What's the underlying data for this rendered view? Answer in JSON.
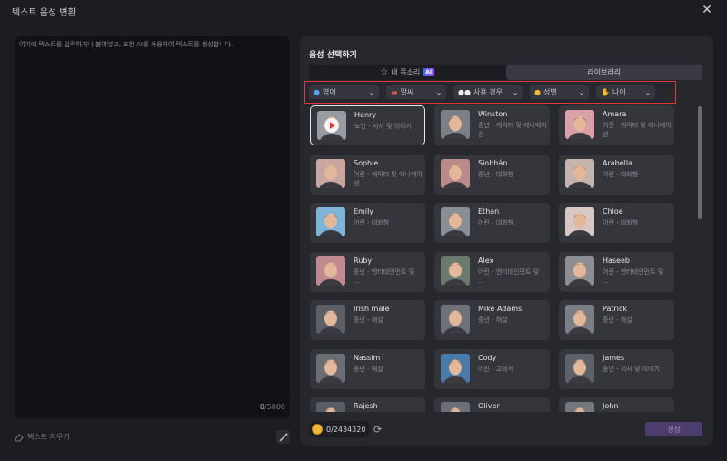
{
  "window": {
    "title": "텍스트 음성 변환"
  },
  "editor": {
    "placeholder": "여기에 텍스트를 입력하거나 붙여넣고, 또한 AI를 사용하여 텍스트를 생성합니다.",
    "count": "0",
    "max": "/5000",
    "clear_label": "텍스트 지우기"
  },
  "voice_panel": {
    "title": "음성 선택하기",
    "tabs": [
      {
        "label": "내 목소리",
        "badge": "AI",
        "active": false
      },
      {
        "label": "라이브러리",
        "active": true
      }
    ],
    "filters": [
      {
        "label": "영어",
        "icon": "globe-icon"
      },
      {
        "label": "말씨",
        "icon": "flag-icon"
      },
      {
        "label": "사용 경우",
        "icon": "eyes-icon"
      },
      {
        "label": "성별",
        "icon": "person-icon"
      },
      {
        "label": "나이",
        "icon": "hand-icon"
      }
    ],
    "voices": [
      {
        "name": "Henry",
        "desc": "노인 - 서사 및 이야기",
        "selected": true
      },
      {
        "name": "Winston",
        "desc": "중년 - 캐릭터 및 애니메이션"
      },
      {
        "name": "Amara",
        "desc": "어린 - 캐릭터 및 애니메이션"
      },
      {
        "name": "Sophie",
        "desc": "어린 - 캐릭터 및 애니메이션"
      },
      {
        "name": "Siobhán",
        "desc": "중년 - 대화형"
      },
      {
        "name": "Arabella",
        "desc": "어린 - 대화형"
      },
      {
        "name": "Emily",
        "desc": "어린 - 대화형"
      },
      {
        "name": "Ethan",
        "desc": "어린 - 대화형"
      },
      {
        "name": "Chloe",
        "desc": "어린 - 대화형"
      },
      {
        "name": "Ruby",
        "desc": "중년 - 엔터테인먼트 및 ..."
      },
      {
        "name": "Alex",
        "desc": "어린 - 엔터테인먼트 및 ..."
      },
      {
        "name": "Haseeb",
        "desc": "어린 - 엔터테인먼트 및 ..."
      },
      {
        "name": "Irish male",
        "desc": "중년 - 해설"
      },
      {
        "name": "Mike Adams",
        "desc": "중년 - 해설"
      },
      {
        "name": "Patrick",
        "desc": "중년 - 해설"
      },
      {
        "name": "Nassim",
        "desc": "중년 - 해설"
      },
      {
        "name": "Cody",
        "desc": "어린 - 교육적"
      },
      {
        "name": "James",
        "desc": "중년 - 서사 및 이야기"
      },
      {
        "name": "Rajesh",
        "desc": ""
      },
      {
        "name": "Oliver",
        "desc": ""
      },
      {
        "name": "John",
        "desc": ""
      }
    ],
    "credits": "0/2434320",
    "generate_label": "생성"
  },
  "colors": {
    "accent_red": "#e0373a",
    "generate_bg": "#4d3d6e",
    "selected_border": "#e6e6ea"
  }
}
